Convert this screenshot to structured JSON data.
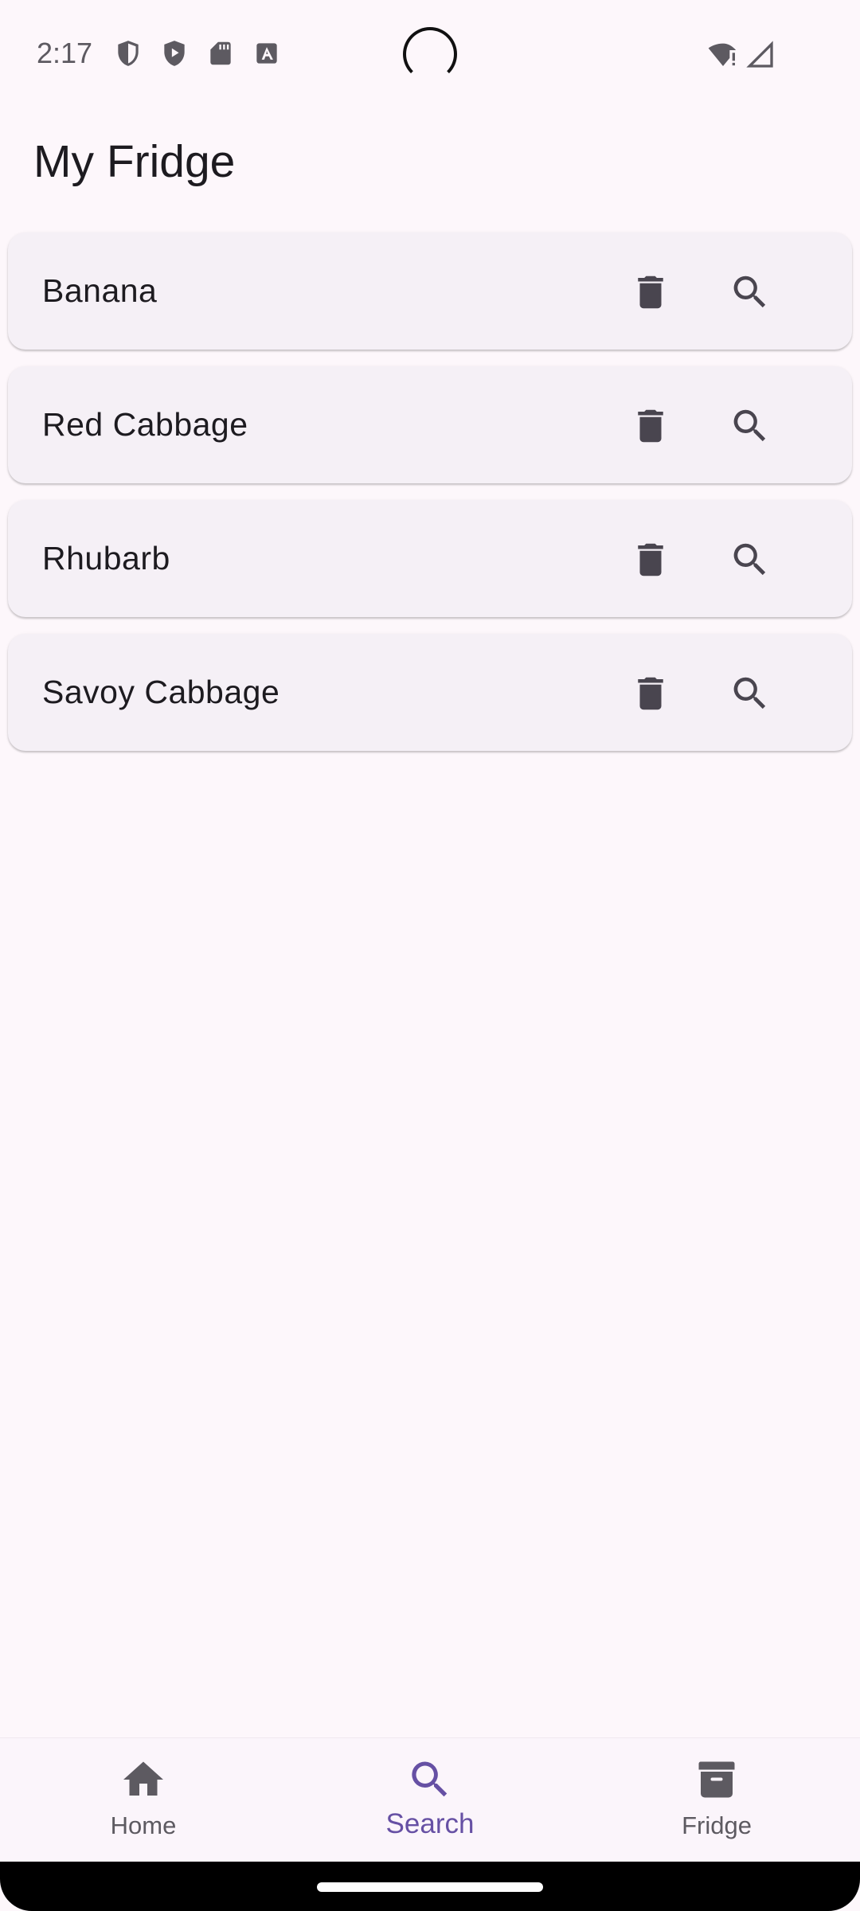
{
  "status_bar": {
    "time": "2:17",
    "left_icons": [
      "shield-outline-icon",
      "shield-play-icon",
      "sd-card-icon",
      "font-a-icon"
    ],
    "right_icons": [
      "wifi-alert-icon",
      "cell-signal-icon"
    ]
  },
  "page": {
    "title": "My Fridge"
  },
  "items": [
    {
      "label": "Banana"
    },
    {
      "label": "Red Cabbage"
    },
    {
      "label": "Rhubarb"
    },
    {
      "label": "Savoy Cabbage"
    }
  ],
  "bottom_nav": {
    "items": [
      {
        "label": "Home",
        "icon": "home-icon",
        "selected": false
      },
      {
        "label": "Search",
        "icon": "search-icon",
        "selected": true
      },
      {
        "label": "Fridge",
        "icon": "archive-box-icon",
        "selected": false
      }
    ]
  },
  "colors": {
    "background": "#fdf7fb",
    "card": "#f5f0f6",
    "icon": "#49454f",
    "accent": "#6650a4",
    "text": "#1d1b20"
  }
}
